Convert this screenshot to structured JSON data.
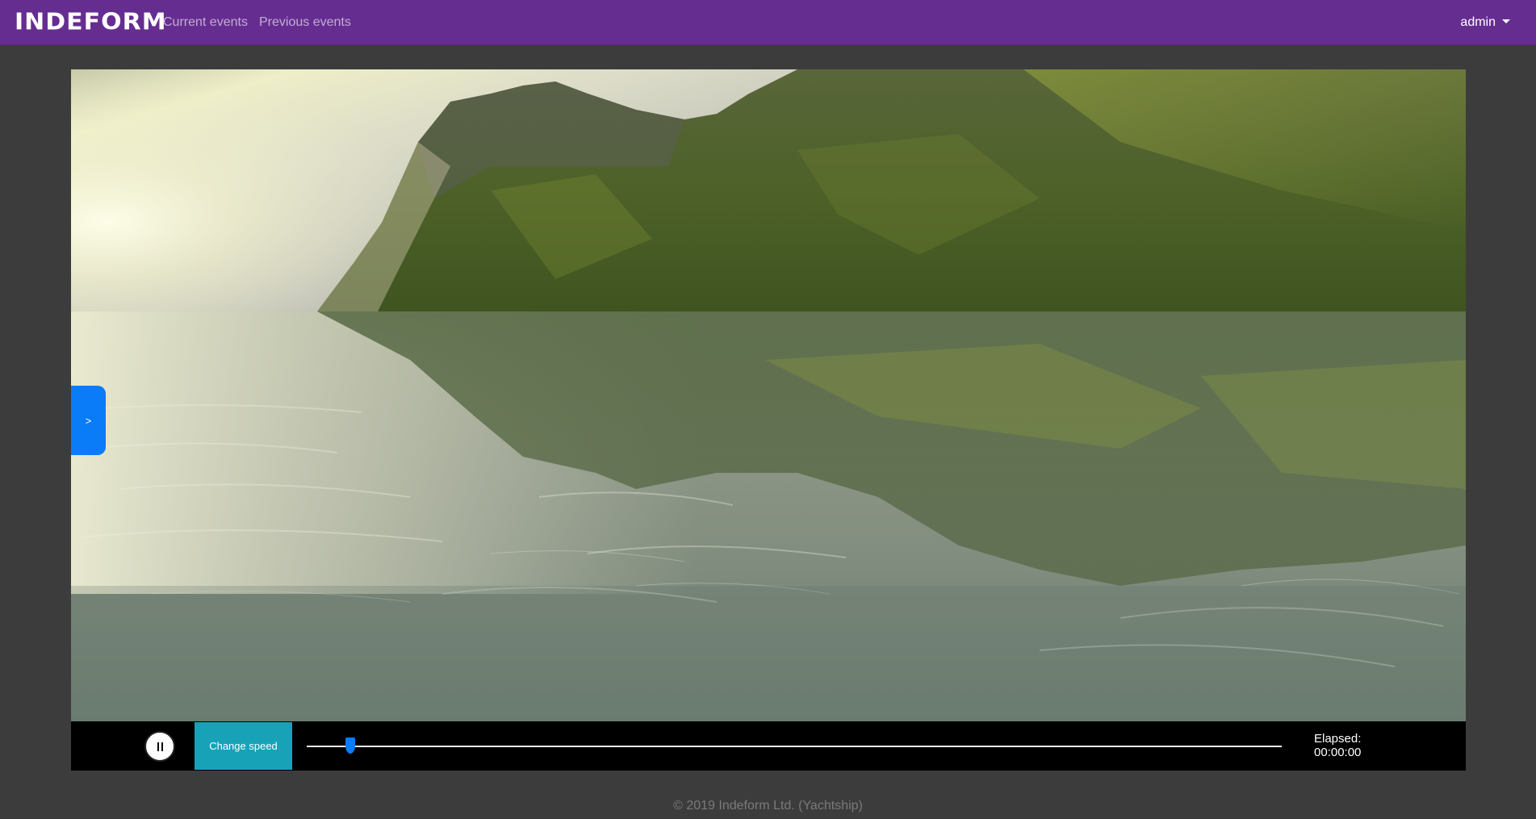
{
  "navbar": {
    "brand": "INDEFORM",
    "links": [
      {
        "label": "Current events"
      },
      {
        "label": "Previous events"
      }
    ],
    "user": "admin",
    "bg_color": "#662d91"
  },
  "viewer": {
    "scene": "3D render: mountains reflected on water with bright sky",
    "side_toggle_label": ">"
  },
  "controls": {
    "speed_button_label": "Change speed",
    "speed_button_color": "#17a2b8",
    "progress": 0.045,
    "elapsed_label": "Elapsed:",
    "elapsed_value": "00:00:00",
    "play_icon": "pause-icon"
  },
  "footer": {
    "text": "© 2019 Indeform Ltd. (Yachtship)"
  }
}
